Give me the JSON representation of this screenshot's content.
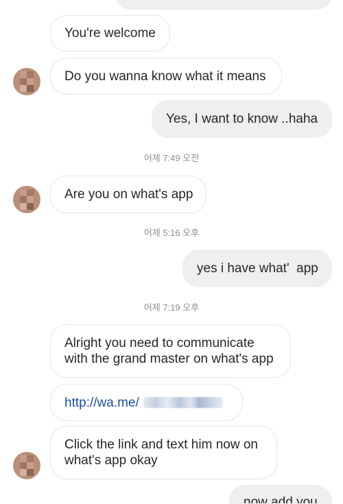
{
  "messages": [
    {
      "id": "m0",
      "dir": "out",
      "text": ""
    },
    {
      "id": "m1",
      "dir": "in",
      "text": "You're welcome"
    },
    {
      "id": "m2",
      "dir": "in",
      "text": "Do you wanna know what it means"
    },
    {
      "id": "m3",
      "dir": "out",
      "text": "Yes, I want to know ..haha"
    },
    {
      "id": "m4",
      "dir": "in",
      "text": "Are you on what's app"
    },
    {
      "id": "m5",
      "dir": "out",
      "text": "yes i have what'  app"
    },
    {
      "id": "m6",
      "dir": "in",
      "lines": [
        "Alright you need to communicate",
        "with the grand master on what's app"
      ]
    },
    {
      "id": "m7",
      "dir": "in",
      "text": "http://wa.me/"
    },
    {
      "id": "m8",
      "dir": "in",
      "lines": [
        "Click the link and text him now on",
        "what's app okay"
      ]
    },
    {
      "id": "m9",
      "dir": "out",
      "text": "now add you"
    }
  ],
  "timestamps": [
    "어제 7:49 오전",
    "어제 5:16 오후",
    "어제 7:19 오후"
  ],
  "colors": {
    "incoming_bg": "#ffffff",
    "incoming_border": "#e6e6e6",
    "outgoing_bg": "#efefef",
    "link": "#1a4fa0",
    "timestamp": "#8e8e8e"
  },
  "icons": {
    "avatar": "blurred-profile-avatar",
    "redaction": "pixelated-phone-number"
  }
}
